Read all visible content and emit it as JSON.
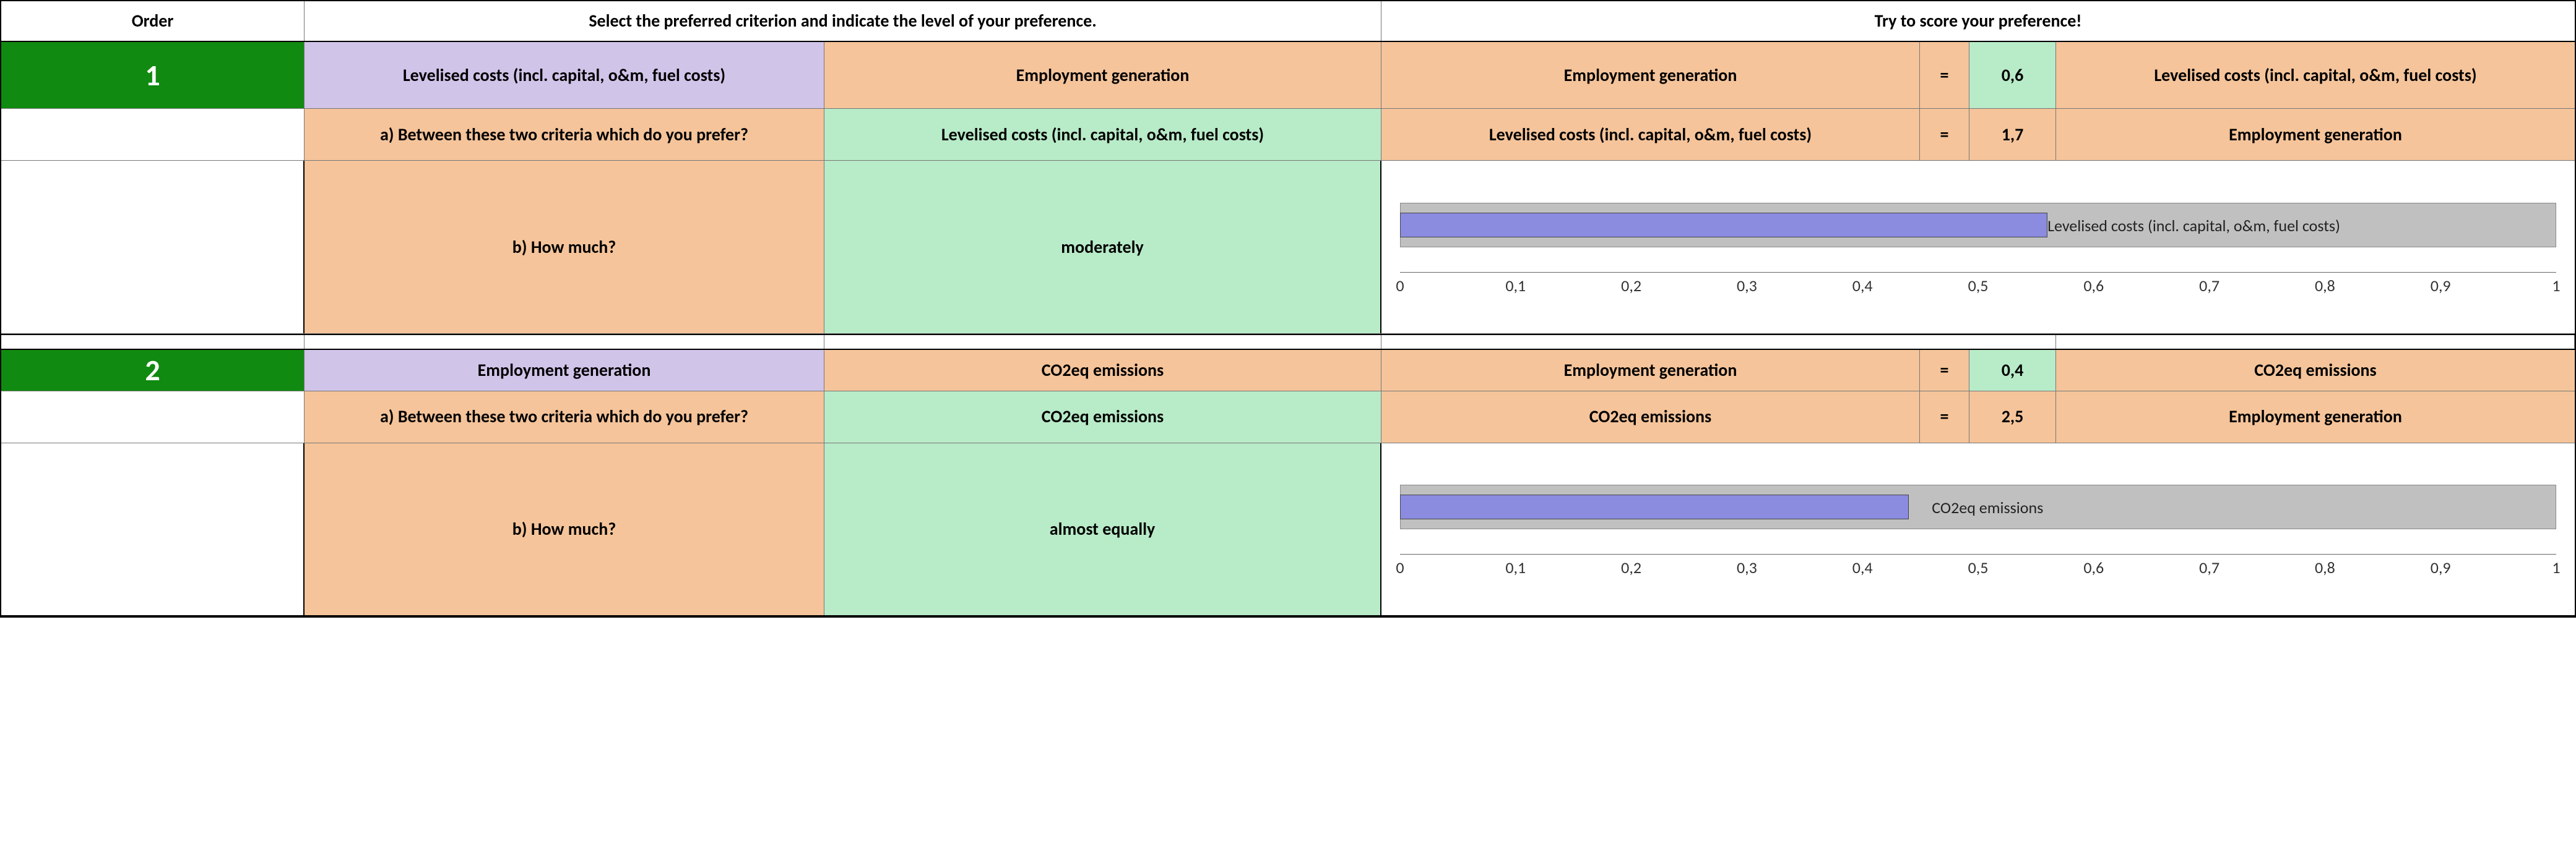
{
  "headers": {
    "order": "Order",
    "select": "Select the preferred criterion and indicate the level of your preference.",
    "score": "Try to score your preference!"
  },
  "questions": {
    "a": "a) Between these two criteria which do you prefer?",
    "b": "b) How much?"
  },
  "eq": "=",
  "axis_ticks": [
    "0",
    "0,1",
    "0,2",
    "0,3",
    "0,4",
    "0,5",
    "0,6",
    "0,7",
    "0,8",
    "0,9",
    "1"
  ],
  "rows": [
    {
      "order": "1",
      "criterion_a": "Levelised costs (incl. capital, o&m, fuel costs)",
      "criterion_b": "Employment generation",
      "chosen": "Levelised costs (incl. capital, o&m, fuel costs)",
      "howmuch": "moderately",
      "score1_left": "Employment generation",
      "score1_val": "0,6",
      "score1_right": "Levelised costs (incl. capital, o&m, fuel costs)",
      "score2_left": "Levelised costs (incl. capital, o&m, fuel costs)",
      "score2_val": "1,7",
      "score2_right": "Employment generation",
      "chart_label": "Levelised costs (incl. capital, o&m, fuel costs)",
      "chart_value": 0.56,
      "chart_label_left": 0.56
    },
    {
      "order": "2",
      "criterion_a": "Employment generation",
      "criterion_b": "CO2eq emissions",
      "chosen": "CO2eq emissions",
      "howmuch": "almost equally",
      "score1_left": "Employment generation",
      "score1_val": "0,4",
      "score1_right": "CO2eq emissions",
      "score2_left": "CO2eq emissions",
      "score2_val": "2,5",
      "score2_right": "Employment generation",
      "chart_label": "CO2eq emissions",
      "chart_value": 0.44,
      "chart_label_left": 0.46
    }
  ],
  "chart_data": [
    {
      "type": "bar",
      "title": "",
      "xlabel": "",
      "ylabel": "",
      "xlim": [
        0,
        1
      ],
      "categories": [
        "Levelised costs (incl. capital, o&m, fuel costs)"
      ],
      "values": [
        0.56
      ],
      "background_bar": 1.0
    },
    {
      "type": "bar",
      "title": "",
      "xlabel": "",
      "ylabel": "",
      "xlim": [
        0,
        1
      ],
      "categories": [
        "CO2eq emissions"
      ],
      "values": [
        0.44
      ],
      "background_bar": 1.0
    }
  ]
}
